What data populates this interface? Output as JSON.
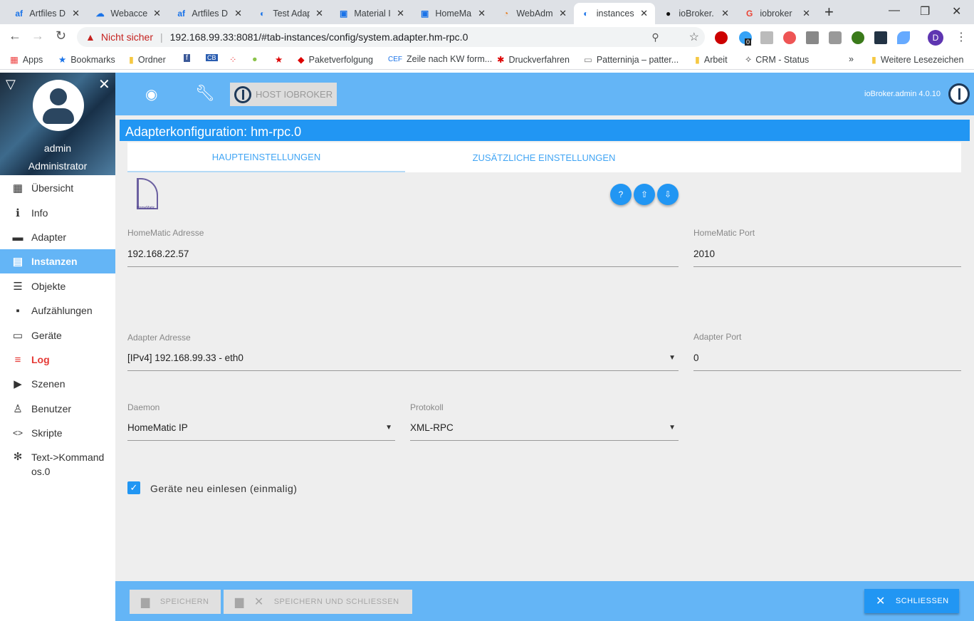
{
  "browser": {
    "tabs": [
      {
        "icon": "af",
        "label": "Artfiles D"
      },
      {
        "icon": "☁",
        "label": "Webacce"
      },
      {
        "icon": "af",
        "label": "Artfiles D"
      },
      {
        "icon": "◐",
        "label": "Test Adap"
      },
      {
        "icon": "▣",
        "label": "Material I"
      },
      {
        "icon": "▣",
        "label": "HomeMa"
      },
      {
        "icon": "◔",
        "label": "WebAdm"
      },
      {
        "icon": "◐",
        "label": "instances"
      },
      {
        "icon": "●",
        "label": "ioBroker."
      },
      {
        "icon": "G",
        "label": "iobroker"
      }
    ],
    "security": "Nicht sicher",
    "url": "192.168.99.33:8081/#tab-instances/config/system.adapter.hm-rpc.0",
    "profile_initial": "D",
    "ghost_badge": "0",
    "bookmarks": [
      "Apps",
      "Bookmarks",
      "Ordner",
      "Paketverfolgung",
      "Zeile nach KW form...",
      "Druckverfahren",
      "Patterninja – patter...",
      "Arbeit",
      "CRM - Status"
    ],
    "more_bookmarks": "»",
    "other_bookmarks": "Weitere Lesezeichen"
  },
  "sidebar": {
    "user": "admin",
    "role": "Administrator",
    "items": [
      {
        "icon": "▦",
        "label": "Übersicht"
      },
      {
        "icon": "ℹ",
        "label": "Info"
      },
      {
        "icon": "▬",
        "label": "Adapter"
      },
      {
        "icon": "▤",
        "label": "Instanzen"
      },
      {
        "icon": "☰",
        "label": "Objekte"
      },
      {
        "icon": "▪",
        "label": "Aufzählungen"
      },
      {
        "icon": "▭",
        "label": "Geräte"
      },
      {
        "icon": "≡",
        "label": "Log"
      },
      {
        "icon": "▶",
        "label": "Szenen"
      },
      {
        "icon": "♙",
        "label": "Benutzer"
      },
      {
        "icon": "<>",
        "label": "Skripte"
      },
      {
        "icon": "✻",
        "label": "Text->Kommandos.0"
      }
    ]
  },
  "header": {
    "host": "HOST IOBROKER",
    "version": "ioBroker.admin 4.0.10"
  },
  "config": {
    "title": "Adapterkonfiguration: hm-rpc.0",
    "tabs": [
      "HAUPTEINSTELLUNGEN",
      "ZUSÄTZLICHE EINSTELLUNGEN"
    ],
    "logo_text": "HomeMatic",
    "fields": {
      "hm_address": {
        "label": "HomeMatic Adresse",
        "value": "192.168.22.57"
      },
      "hm_port": {
        "label": "HomeMatic Port",
        "value": "2010"
      },
      "adapter_address": {
        "label": "Adapter Adresse",
        "value": "[IPv4] 192.168.99.33 - eth0"
      },
      "adapter_port": {
        "label": "Adapter Port",
        "value": "0"
      },
      "daemon": {
        "label": "Daemon",
        "value": "HomeMatic IP"
      },
      "protocol": {
        "label": "Protokoll",
        "value": "XML-RPC"
      }
    },
    "checkbox": {
      "label": "Geräte neu einlesen (einmalig)",
      "checked": true
    }
  },
  "footer": {
    "save": "SPEICHERN",
    "save_close": "SPEICHERN UND SCHLIESSEN",
    "close": "SCHLIESSEN"
  },
  "colors": {
    "primary": "#2196f3",
    "header": "#64b5f6",
    "log": "#e53935"
  }
}
